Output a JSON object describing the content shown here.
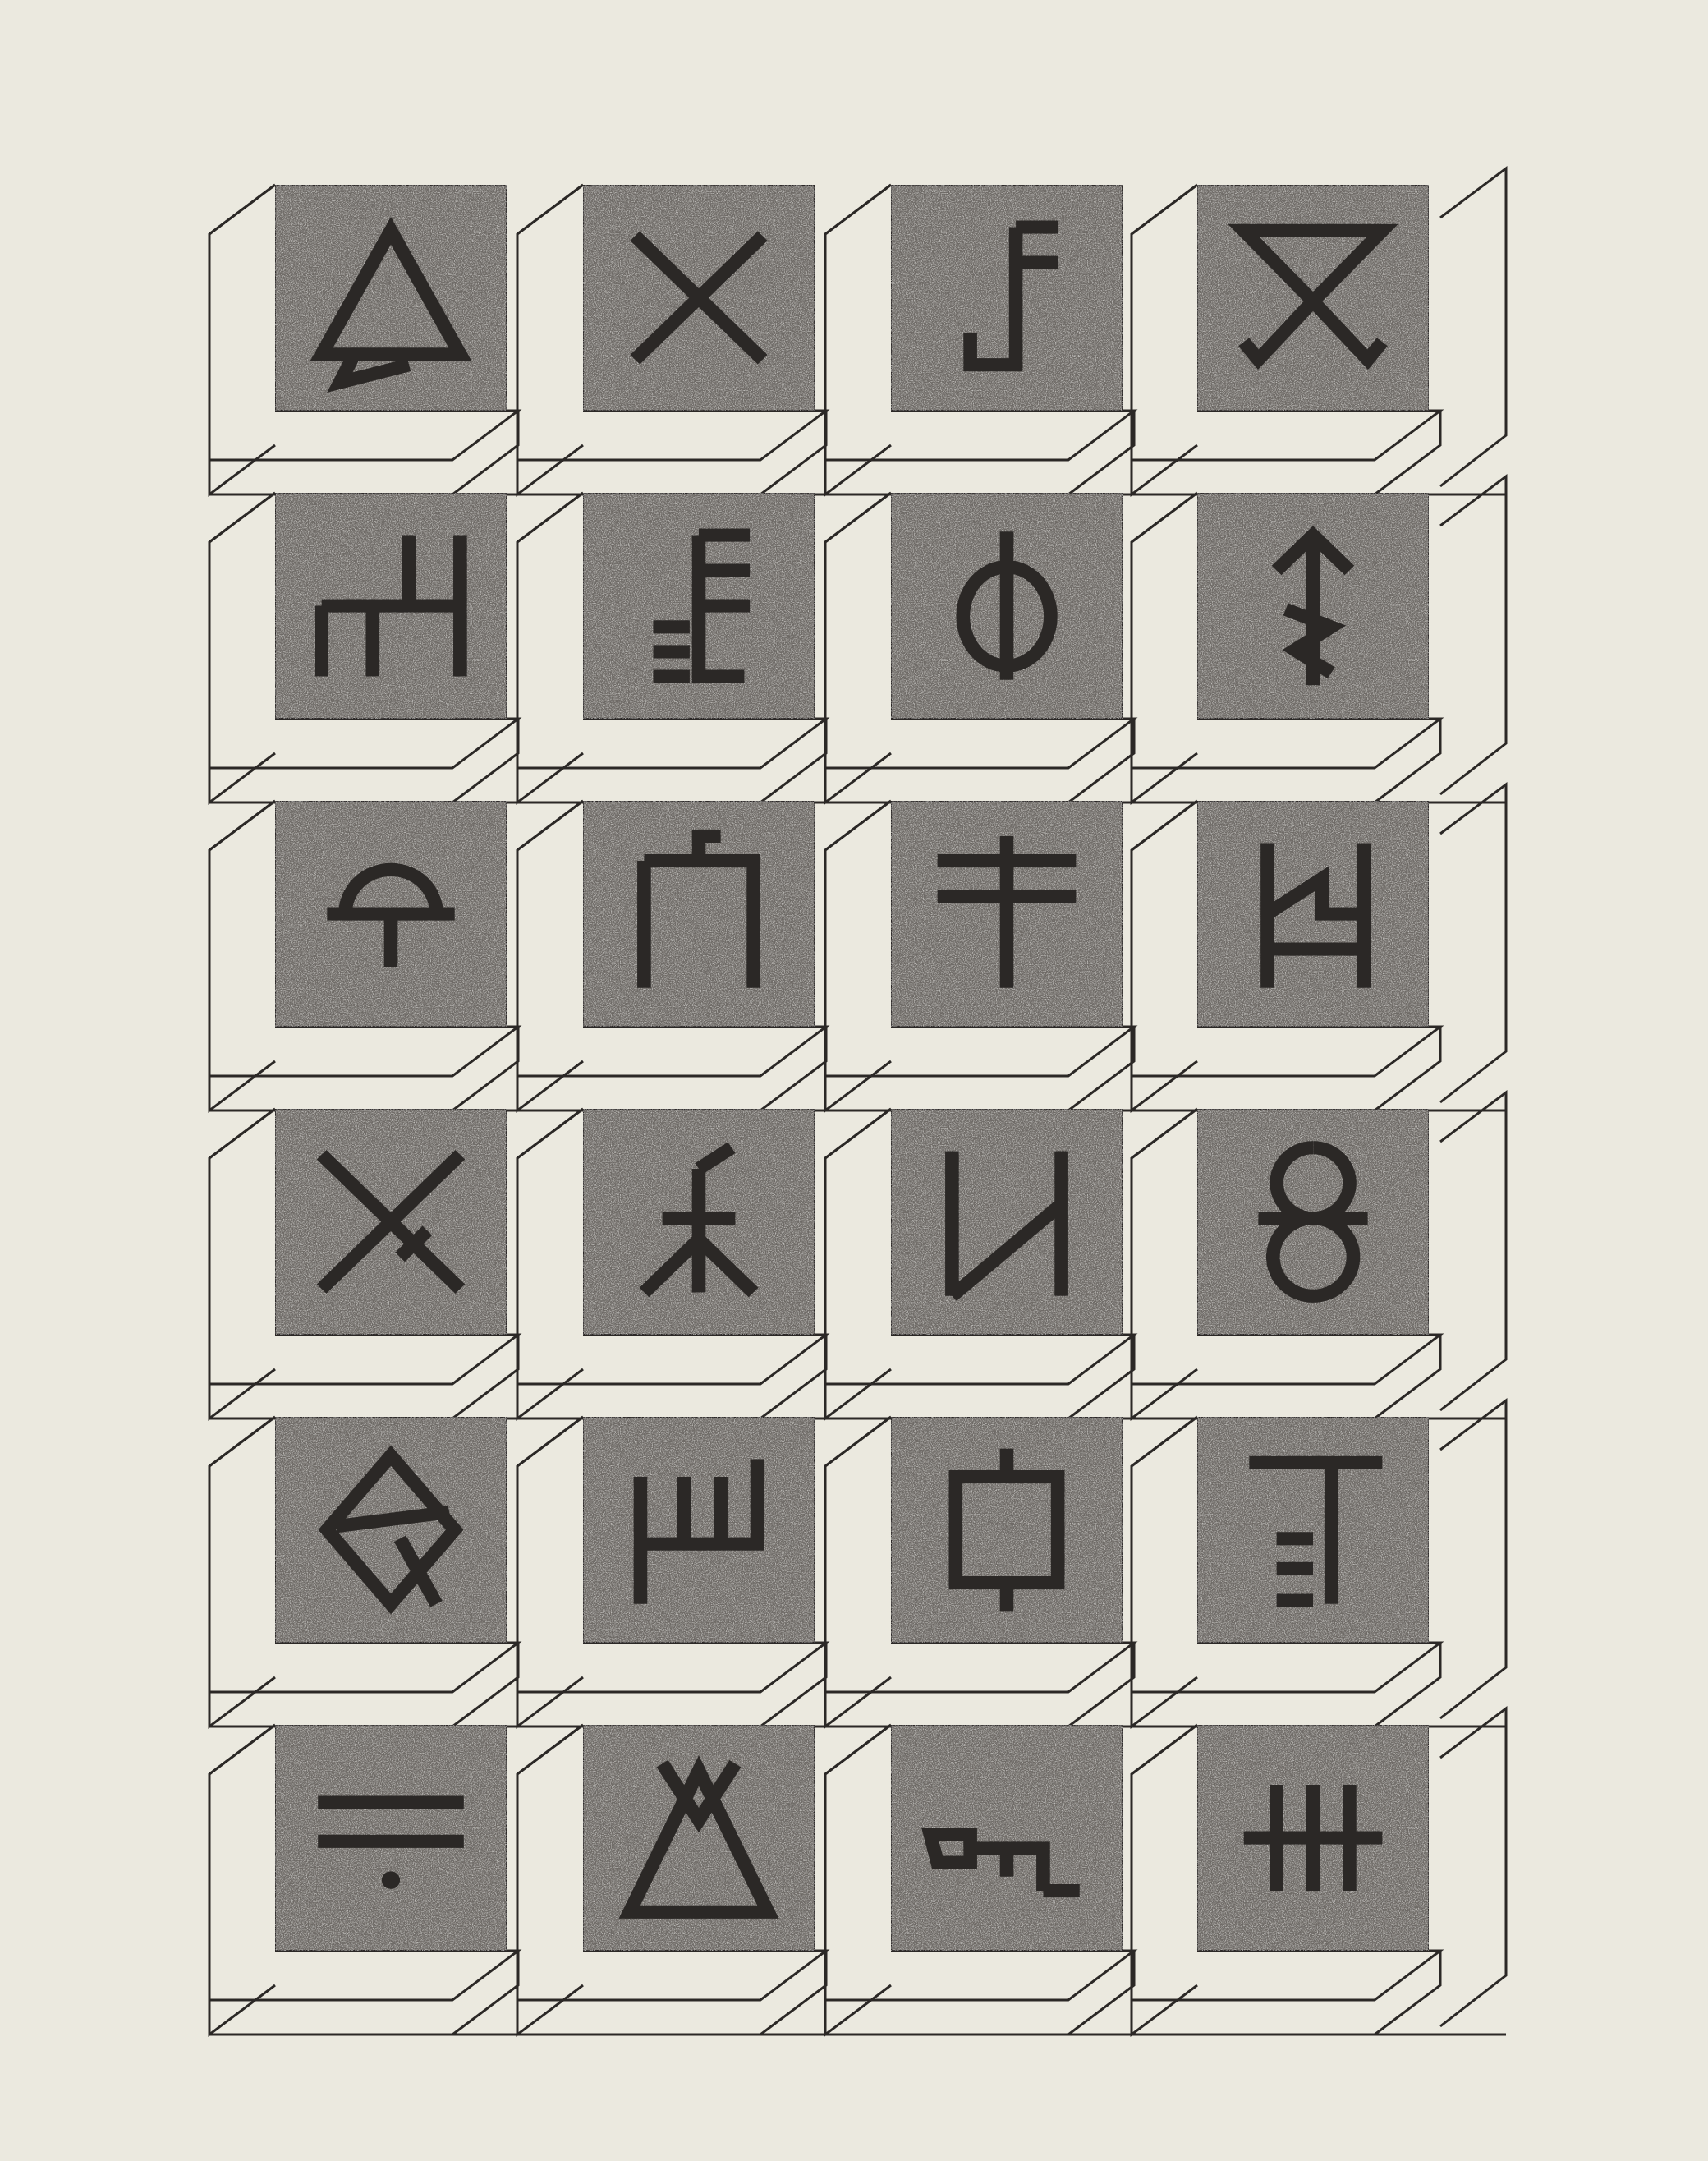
{
  "artwork": {
    "type": "print",
    "paper_color": "#ebe9df",
    "ink_color": "#2b2826",
    "plate_color": "#6e6a66",
    "grid": {
      "rows": 6,
      "columns": 4
    }
  },
  "glyph_rows": [
    [
      "triangle-hook",
      "x-cross",
      "flag-hook",
      "hourglass-cross"
    ],
    [
      "gate-trident",
      "flag-comb",
      "phi-circle",
      "arrow-three"
    ],
    [
      "dome-anchor",
      "arch-post",
      "double-cross",
      "h-stair"
    ],
    [
      "saltire-cross",
      "sprout-cross",
      "reversed-n",
      "twin-loop"
    ],
    [
      "rhombus-r",
      "comb-bracket",
      "square-stem",
      "t-comb"
    ],
    [
      "equals-dot",
      "triangle-x",
      "key-step",
      "triple-bar"
    ]
  ]
}
